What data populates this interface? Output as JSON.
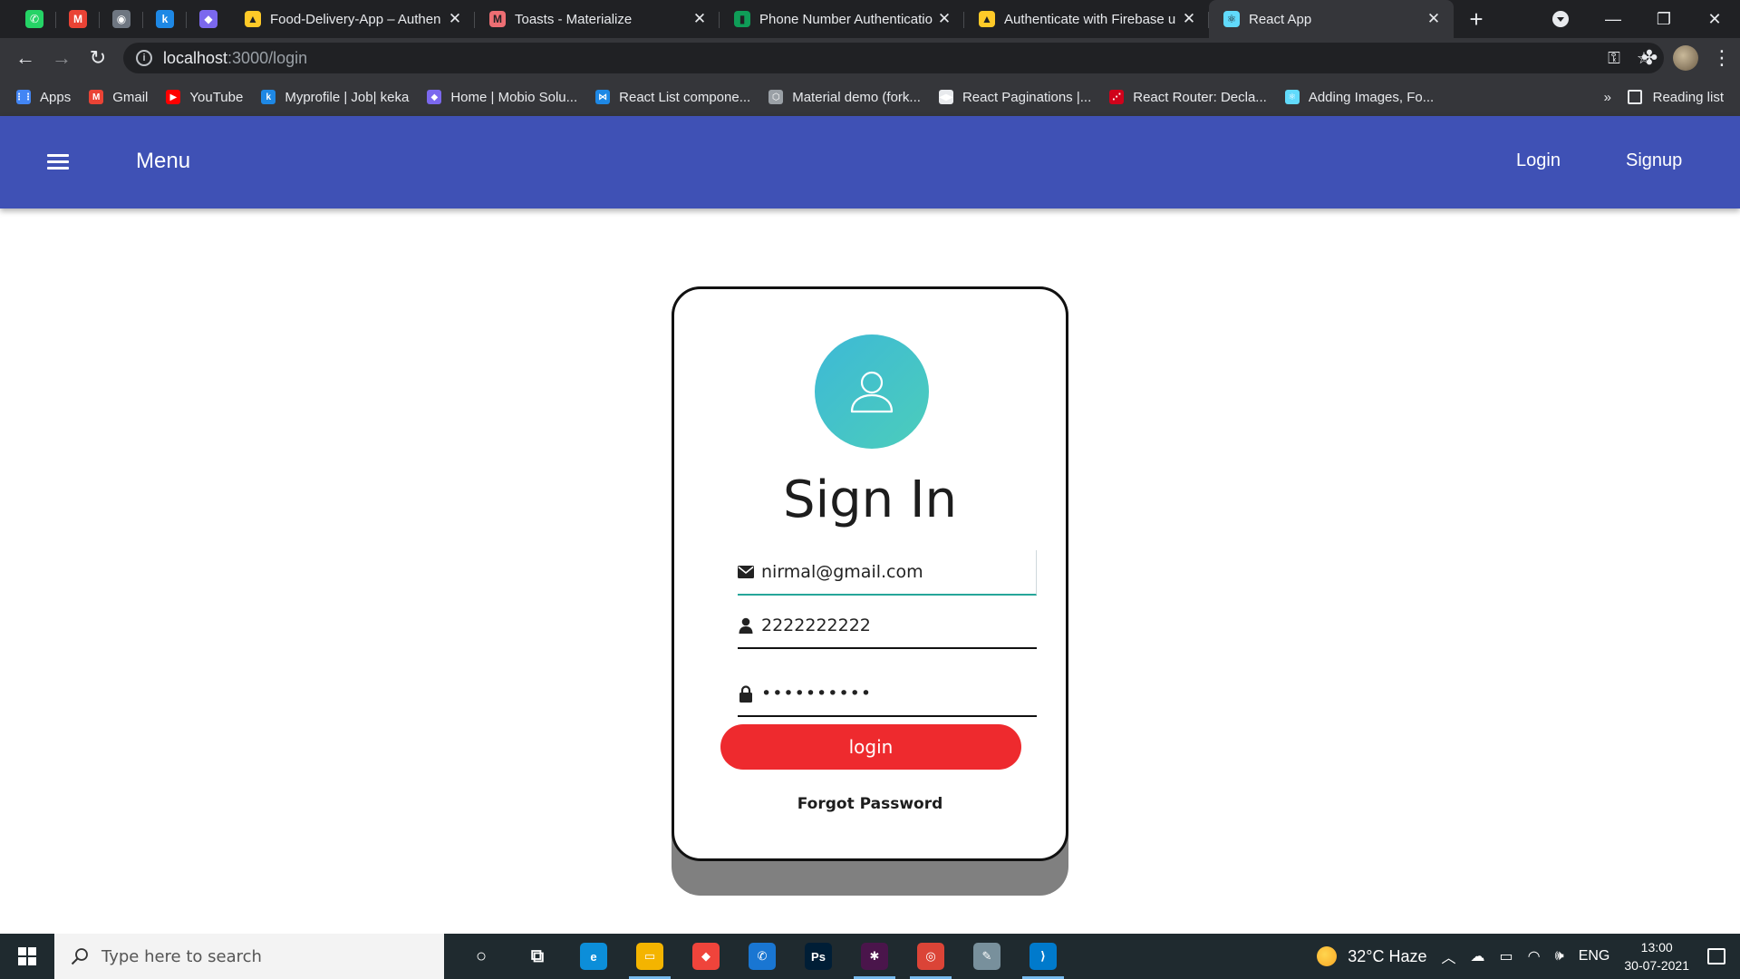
{
  "browser": {
    "pinned_tabs": [
      {
        "icon": "whatsapp-icon",
        "color": "#25d366",
        "glyph": "✆"
      },
      {
        "icon": "gmail-icon",
        "color": "#ea4335",
        "glyph": "M"
      },
      {
        "icon": "github-icon",
        "color": "#6e7681",
        "glyph": "◉"
      },
      {
        "icon": "keka-icon",
        "color": "#1e88e5",
        "glyph": "k"
      },
      {
        "icon": "clickup-icon",
        "color": "#7b68ee",
        "glyph": "◆"
      }
    ],
    "tabs": [
      {
        "title": "Food-Delivery-App – Authen",
        "icon": "firebase-icon",
        "color": "#ffca28",
        "glyph": "▲",
        "active": false
      },
      {
        "title": "Toasts - Materialize",
        "icon": "materialize-icon",
        "color": "#ee6e73",
        "glyph": "M",
        "active": false
      },
      {
        "title": "Phone Number Authenticatio",
        "icon": "document-icon",
        "color": "#0f9d58",
        "glyph": "▮",
        "active": false
      },
      {
        "title": "Authenticate with Firebase u",
        "icon": "firebase-icon",
        "color": "#ffca28",
        "glyph": "▲",
        "active": false
      },
      {
        "title": "React App",
        "icon": "react-icon",
        "color": "#61dafb",
        "glyph": "⚛",
        "active": true
      }
    ],
    "new_tab_label": "+",
    "url_host": "localhost",
    "url_path": ":3000/login",
    "bookmarks": [
      {
        "label": "Apps",
        "icon": "apps-grid-icon",
        "color": "#4285f4",
        "glyph": "⋮⋮"
      },
      {
        "label": "Gmail",
        "icon": "gmail-icon",
        "color": "#ea4335",
        "glyph": "M"
      },
      {
        "label": "YouTube",
        "icon": "youtube-icon",
        "color": "#ff0000",
        "glyph": "▶"
      },
      {
        "label": "Myprofile | Job| keka",
        "icon": "keka-icon",
        "color": "#1e88e5",
        "glyph": "k"
      },
      {
        "label": "Home | Mobio Solu...",
        "icon": "clickup-icon",
        "color": "#7b68ee",
        "glyph": "◆"
      },
      {
        "label": "React List compone...",
        "icon": "mui-icon",
        "color": "#1e88e5",
        "glyph": "⋈"
      },
      {
        "label": "Material demo (fork...",
        "icon": "codesandbox-icon",
        "color": "#9aa0a6",
        "glyph": "⬡"
      },
      {
        "label": "React Paginations |...",
        "icon": "pagination-icon",
        "color": "#e8eaed",
        "glyph": "◀▶"
      },
      {
        "label": "React Router: Decla...",
        "icon": "react-router-icon",
        "color": "#d0021b",
        "glyph": "⋰"
      },
      {
        "label": "Adding Images, Fo...",
        "icon": "react-icon",
        "color": "#61dafb",
        "glyph": "⚛"
      }
    ],
    "bookmarks_overflow": "»",
    "reading_list_label": "Reading list"
  },
  "app": {
    "menu_title": "Menu",
    "nav": {
      "login": "Login",
      "signup": "Signup"
    },
    "header_color": "#3f51b5"
  },
  "signin": {
    "title": "Sign In",
    "email_value": "nirmal@gmail.com",
    "phone_value": "2222222222",
    "password_value": "••••••••••",
    "login_button": "login",
    "forgot_password": "Forgot Password",
    "button_color": "#ee2a2e",
    "avatar_gradient": [
      "#3db9d6",
      "#4ccdbb"
    ]
  },
  "taskbar": {
    "search_placeholder": "Type here to search",
    "apps": [
      {
        "icon": "cortana-icon",
        "color": "transparent",
        "glyph": "○",
        "running": false
      },
      {
        "icon": "task-view-icon",
        "color": "transparent",
        "glyph": "⧉",
        "running": false
      },
      {
        "icon": "edge-icon",
        "color": "#0c8ed9",
        "glyph": "e",
        "running": false
      },
      {
        "icon": "file-explorer-icon",
        "color": "#f4b400",
        "glyph": "▭",
        "running": true
      },
      {
        "icon": "anydesk-icon",
        "color": "#ef443b",
        "glyph": "◆",
        "running": false
      },
      {
        "icon": "whatsapp-icon",
        "color": "#1976d2",
        "glyph": "✆",
        "running": false
      },
      {
        "icon": "photoshop-icon",
        "color": "#001e36",
        "glyph": "Ps",
        "running": false
      },
      {
        "icon": "slack-icon",
        "color": "#4a154b",
        "glyph": "✱",
        "running": true
      },
      {
        "icon": "chrome-icon",
        "color": "#db4437",
        "glyph": "◎",
        "running": true
      },
      {
        "icon": "notepad-icon",
        "color": "#78909c",
        "glyph": "✎",
        "running": false
      },
      {
        "icon": "vscode-icon",
        "color": "#007acc",
        "glyph": "⟩",
        "running": true
      }
    ],
    "weather": "32°C  Haze",
    "language": "ENG",
    "time": "13:00",
    "date": "30-07-2021"
  }
}
